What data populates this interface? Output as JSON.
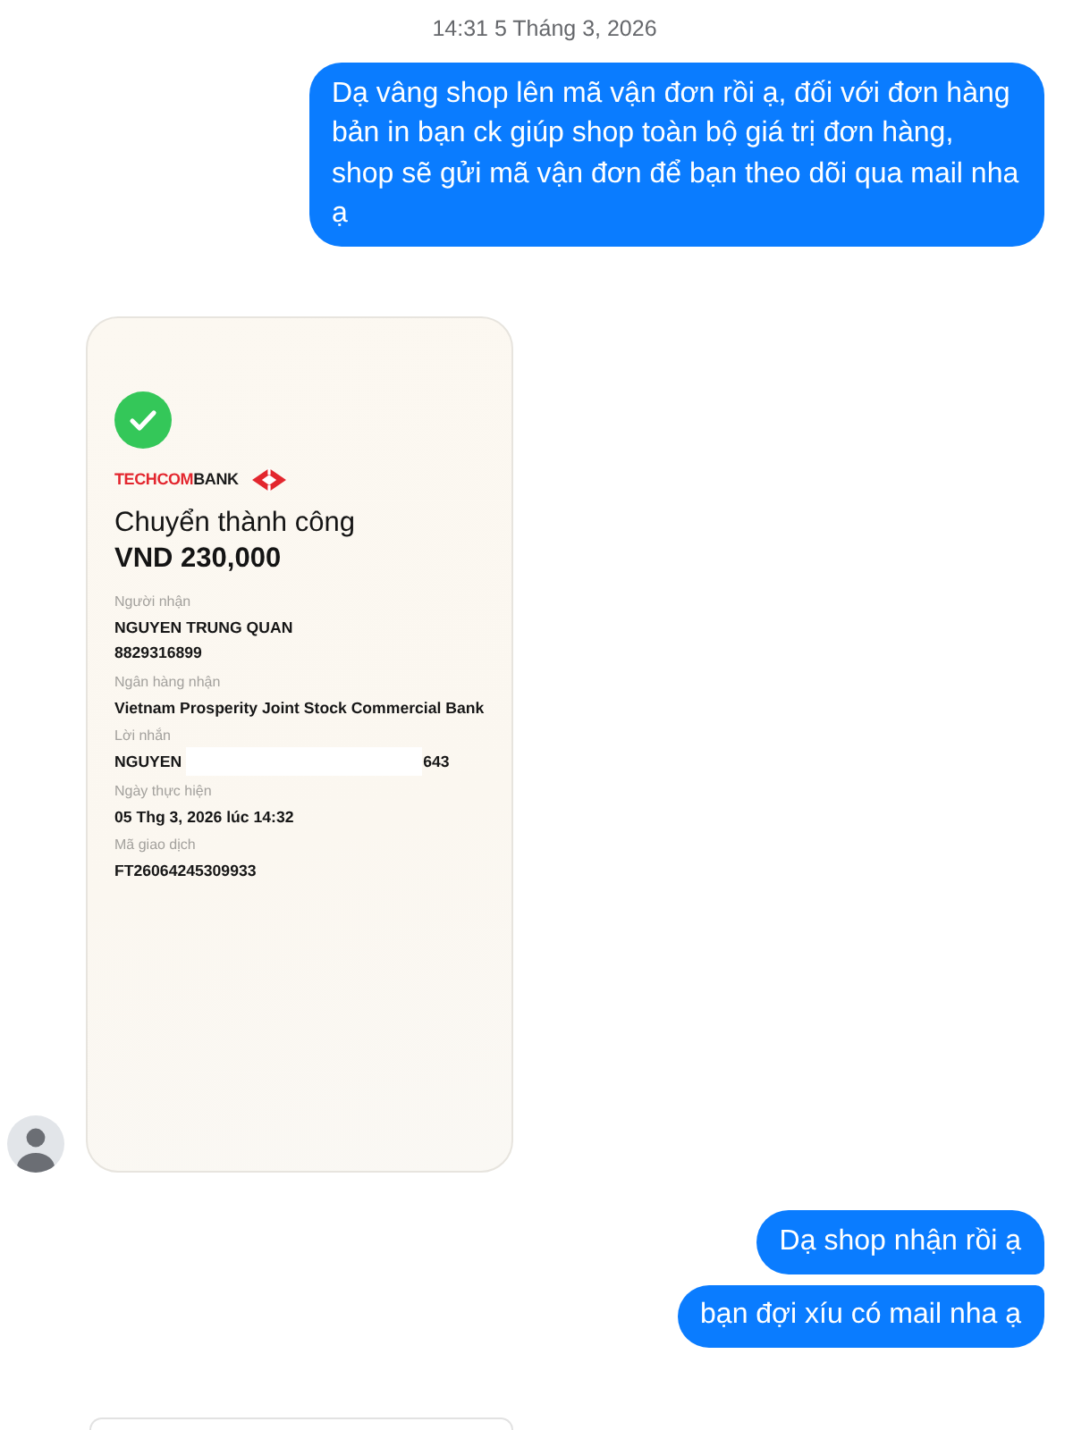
{
  "timestamp": "14:31 5 Tháng 3, 2026",
  "messages": [
    {
      "kind": "text",
      "outgoing": true,
      "text": "Dạ vâng shop lên mã vận đơn rồi ạ, đối với đơn hàng bản in bạn ck giúp shop toàn bộ giá trị đơn hàng, shop sẽ gửi mã vận đơn để bạn theo dõi qua mail nha ạ"
    },
    {
      "kind": "receipt",
      "outgoing": false,
      "show_avatar": true,
      "receipt": {
        "logo_parts": [
          {
            "text": "TECHCOM",
            "color": "#e3262e"
          },
          {
            "text": "BANK",
            "color": "#1c1c1c"
          }
        ],
        "status": "Chuyển thành công",
        "amount": "VND 230,000",
        "fields": [
          {
            "label": "Người nhận",
            "lines": [
              {
                "text": "NGUYEN TRUNG QUAN",
                "redacted": false
              },
              {
                "text": "8829316899",
                "redacted": false
              }
            ]
          },
          {
            "label": "Ngân hàng nhận",
            "lines": [
              {
                "text": "Vietnam Prosperity Joint Stock Commercial Bank",
                "redacted": false
              }
            ]
          },
          {
            "label": "Lời nhắn",
            "lines": [
              {
                "text": "NGUYEN",
                "redacted": true,
                "tail": "643"
              }
            ]
          },
          {
            "label": "Ngày thực hiện",
            "lines": [
              {
                "text": "05 Thg 3, 2026 lúc 14:32",
                "redacted": false
              }
            ]
          },
          {
            "label": "Mã giao dịch",
            "lines": [
              {
                "text": "FT26064245309933",
                "redacted": false
              }
            ]
          }
        ]
      }
    },
    {
      "kind": "text",
      "outgoing": true,
      "text": "Dạ shop nhận rồi ạ"
    },
    {
      "kind": "text",
      "outgoing": true,
      "text": "bạn đợi xíu có mail nha ạ"
    },
    {
      "kind": "attachment",
      "outgoing": false,
      "show_avatar": false
    }
  ]
}
